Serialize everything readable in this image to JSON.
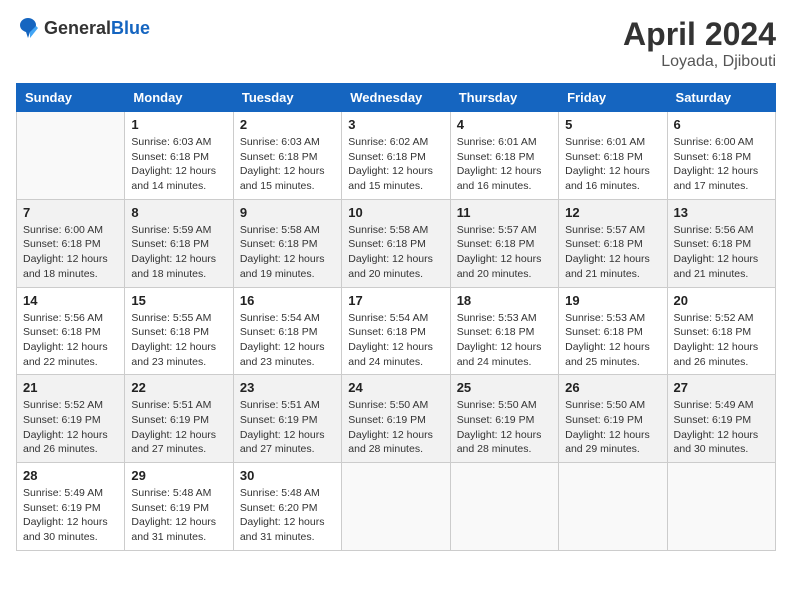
{
  "header": {
    "logo_general": "General",
    "logo_blue": "Blue",
    "month_year": "April 2024",
    "location": "Loyada, Djibouti"
  },
  "weekdays": [
    "Sunday",
    "Monday",
    "Tuesday",
    "Wednesday",
    "Thursday",
    "Friday",
    "Saturday"
  ],
  "weeks": [
    [
      {
        "day": "",
        "info": ""
      },
      {
        "day": "1",
        "info": "Sunrise: 6:03 AM\nSunset: 6:18 PM\nDaylight: 12 hours\nand 14 minutes."
      },
      {
        "day": "2",
        "info": "Sunrise: 6:03 AM\nSunset: 6:18 PM\nDaylight: 12 hours\nand 15 minutes."
      },
      {
        "day": "3",
        "info": "Sunrise: 6:02 AM\nSunset: 6:18 PM\nDaylight: 12 hours\nand 15 minutes."
      },
      {
        "day": "4",
        "info": "Sunrise: 6:01 AM\nSunset: 6:18 PM\nDaylight: 12 hours\nand 16 minutes."
      },
      {
        "day": "5",
        "info": "Sunrise: 6:01 AM\nSunset: 6:18 PM\nDaylight: 12 hours\nand 16 minutes."
      },
      {
        "day": "6",
        "info": "Sunrise: 6:00 AM\nSunset: 6:18 PM\nDaylight: 12 hours\nand 17 minutes."
      }
    ],
    [
      {
        "day": "7",
        "info": "Sunrise: 6:00 AM\nSunset: 6:18 PM\nDaylight: 12 hours\nand 18 minutes."
      },
      {
        "day": "8",
        "info": "Sunrise: 5:59 AM\nSunset: 6:18 PM\nDaylight: 12 hours\nand 18 minutes."
      },
      {
        "day": "9",
        "info": "Sunrise: 5:58 AM\nSunset: 6:18 PM\nDaylight: 12 hours\nand 19 minutes."
      },
      {
        "day": "10",
        "info": "Sunrise: 5:58 AM\nSunset: 6:18 PM\nDaylight: 12 hours\nand 20 minutes."
      },
      {
        "day": "11",
        "info": "Sunrise: 5:57 AM\nSunset: 6:18 PM\nDaylight: 12 hours\nand 20 minutes."
      },
      {
        "day": "12",
        "info": "Sunrise: 5:57 AM\nSunset: 6:18 PM\nDaylight: 12 hours\nand 21 minutes."
      },
      {
        "day": "13",
        "info": "Sunrise: 5:56 AM\nSunset: 6:18 PM\nDaylight: 12 hours\nand 21 minutes."
      }
    ],
    [
      {
        "day": "14",
        "info": "Sunrise: 5:56 AM\nSunset: 6:18 PM\nDaylight: 12 hours\nand 22 minutes."
      },
      {
        "day": "15",
        "info": "Sunrise: 5:55 AM\nSunset: 6:18 PM\nDaylight: 12 hours\nand 23 minutes."
      },
      {
        "day": "16",
        "info": "Sunrise: 5:54 AM\nSunset: 6:18 PM\nDaylight: 12 hours\nand 23 minutes."
      },
      {
        "day": "17",
        "info": "Sunrise: 5:54 AM\nSunset: 6:18 PM\nDaylight: 12 hours\nand 24 minutes."
      },
      {
        "day": "18",
        "info": "Sunrise: 5:53 AM\nSunset: 6:18 PM\nDaylight: 12 hours\nand 24 minutes."
      },
      {
        "day": "19",
        "info": "Sunrise: 5:53 AM\nSunset: 6:18 PM\nDaylight: 12 hours\nand 25 minutes."
      },
      {
        "day": "20",
        "info": "Sunrise: 5:52 AM\nSunset: 6:18 PM\nDaylight: 12 hours\nand 26 minutes."
      }
    ],
    [
      {
        "day": "21",
        "info": "Sunrise: 5:52 AM\nSunset: 6:19 PM\nDaylight: 12 hours\nand 26 minutes."
      },
      {
        "day": "22",
        "info": "Sunrise: 5:51 AM\nSunset: 6:19 PM\nDaylight: 12 hours\nand 27 minutes."
      },
      {
        "day": "23",
        "info": "Sunrise: 5:51 AM\nSunset: 6:19 PM\nDaylight: 12 hours\nand 27 minutes."
      },
      {
        "day": "24",
        "info": "Sunrise: 5:50 AM\nSunset: 6:19 PM\nDaylight: 12 hours\nand 28 minutes."
      },
      {
        "day": "25",
        "info": "Sunrise: 5:50 AM\nSunset: 6:19 PM\nDaylight: 12 hours\nand 28 minutes."
      },
      {
        "day": "26",
        "info": "Sunrise: 5:50 AM\nSunset: 6:19 PM\nDaylight: 12 hours\nand 29 minutes."
      },
      {
        "day": "27",
        "info": "Sunrise: 5:49 AM\nSunset: 6:19 PM\nDaylight: 12 hours\nand 30 minutes."
      }
    ],
    [
      {
        "day": "28",
        "info": "Sunrise: 5:49 AM\nSunset: 6:19 PM\nDaylight: 12 hours\nand 30 minutes."
      },
      {
        "day": "29",
        "info": "Sunrise: 5:48 AM\nSunset: 6:19 PM\nDaylight: 12 hours\nand 31 minutes."
      },
      {
        "day": "30",
        "info": "Sunrise: 5:48 AM\nSunset: 6:20 PM\nDaylight: 12 hours\nand 31 minutes."
      },
      {
        "day": "",
        "info": ""
      },
      {
        "day": "",
        "info": ""
      },
      {
        "day": "",
        "info": ""
      },
      {
        "day": "",
        "info": ""
      }
    ]
  ]
}
